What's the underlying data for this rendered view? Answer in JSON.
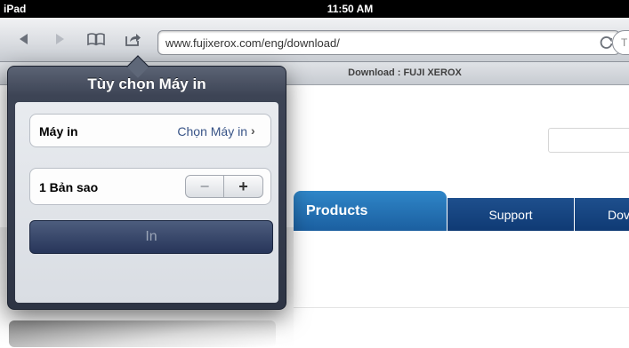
{
  "status_bar": {
    "carrier": "iPad",
    "time": "11:50 AM"
  },
  "browser": {
    "url": "www.fujixerox.com/eng/download/",
    "search_placeholder": "T",
    "tab_title": "Download : FUJI XEROX",
    "icons": [
      "back-arrow-icon",
      "forward-arrow-icon",
      "bookmarks-icon",
      "share-icon",
      "reload-icon"
    ]
  },
  "page": {
    "nav_tabs": [
      {
        "label": "Products",
        "selected": true
      },
      {
        "label": "Support",
        "selected": false
      },
      {
        "label": "Dov",
        "selected": false
      }
    ],
    "colors": {
      "products_tab": "#1f6db3",
      "other_tabs": "#153f7a"
    }
  },
  "print_dialog": {
    "title": "Tùy chọn Máy in",
    "printer_label": "Máy in",
    "printer_value": "Chọn Máy in",
    "copies_label": "1 Bản sao",
    "print_button": "In",
    "stepper_minus": "−",
    "stepper_plus": "+"
  }
}
